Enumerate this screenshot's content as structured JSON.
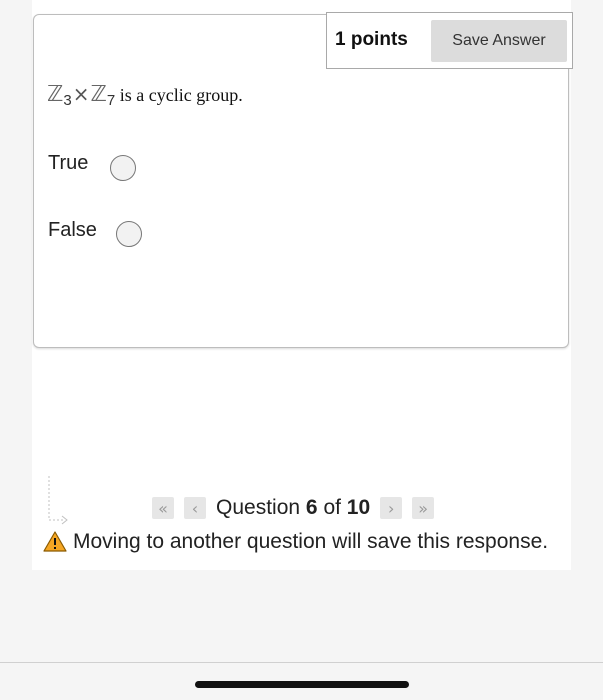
{
  "question": {
    "points_label": "1 points",
    "save_label": "Save Answer",
    "prompt": {
      "set1": "ℤ",
      "sub1": "3",
      "times": "×",
      "set2": "ℤ",
      "sub2": "7",
      "text": " is a cyclic group."
    },
    "options": [
      {
        "label": "True",
        "selected": false
      },
      {
        "label": "False",
        "selected": false
      }
    ]
  },
  "navigation": {
    "first_icon": "«",
    "prev_icon": "‹",
    "next_icon": "›",
    "last_icon": "»",
    "question_word": "Question",
    "current": "6",
    "of_word": "of",
    "total": "10"
  },
  "warning": {
    "icon": "warning-icon",
    "text": "Moving to another question will save this response."
  },
  "colors": {
    "card_border": "#bdbdbd",
    "button_bg": "#dcdcdc",
    "warning_fill": "#f5a623"
  }
}
